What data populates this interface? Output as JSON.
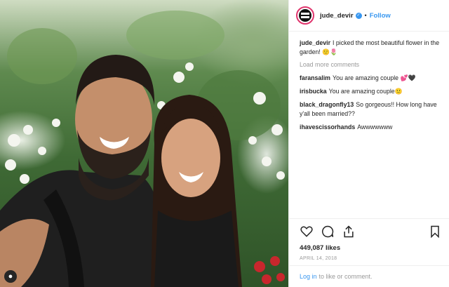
{
  "post": {
    "username": "jude_devir",
    "follow_label": "Follow",
    "separator": "•"
  },
  "caption": {
    "username": "jude_devir",
    "text": "I picked the most beautiful flower in the garden! 🙂🌷"
  },
  "load_more_label": "Load more comments",
  "comments": [
    {
      "username": "faransalim",
      "text": "You are amazing couple 💕🖤"
    },
    {
      "username": "irisbucka",
      "text": "You are amazing couple🙂"
    },
    {
      "username": "black_dragonfly13",
      "text": "So gorgeous!! How long have y'all been married??"
    },
    {
      "username": "ihavescissorhands",
      "text": "Awwwwwww"
    }
  ],
  "likes": "449,087 likes",
  "date": "APRIL 14, 2018",
  "login": {
    "link": "Log in",
    "text": "to like or comment."
  },
  "icons": [
    "heart-icon",
    "comment-icon",
    "share-icon",
    "bookmark-icon",
    "user-icon"
  ],
  "colors": {
    "accent": "#3897f0",
    "story_ring": "#e0356d"
  }
}
